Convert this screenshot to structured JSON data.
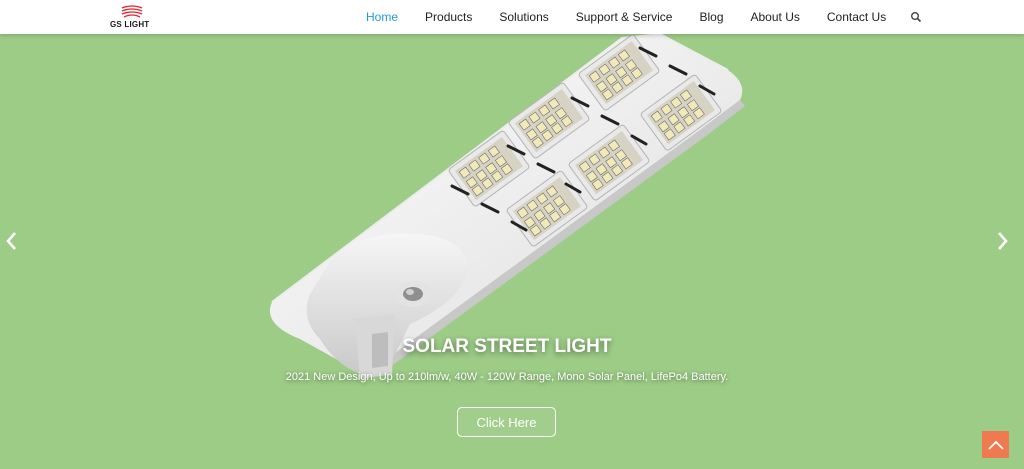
{
  "header": {
    "logo_text": "GS LIGHT",
    "nav": [
      {
        "label": "Home",
        "active": true
      },
      {
        "label": "Products"
      },
      {
        "label": "Solutions"
      },
      {
        "label": "Support & Service"
      },
      {
        "label": "Blog"
      },
      {
        "label": "About Us"
      },
      {
        "label": "Contact Us"
      }
    ],
    "search_icon": "search-icon"
  },
  "hero": {
    "title": "SOLAR STREET LIGHT",
    "subtitle": "2021 New Design, Up to 210lm/w, 40W - 120W Range, Mono Solar Panel, LifePo4 Battery.",
    "cta_label": "Click Here",
    "background_color": "#9ccc86",
    "prev_icon": "chevron-left-icon",
    "next_icon": "chevron-right-icon"
  },
  "back_to_top": {
    "icon": "chevron-up-icon",
    "color": "#ef7a4f"
  }
}
